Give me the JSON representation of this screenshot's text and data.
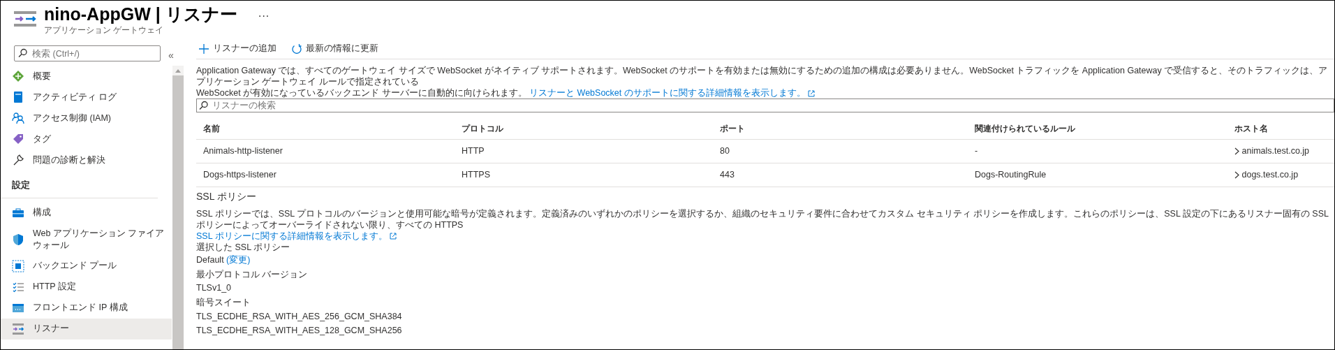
{
  "header": {
    "title": "nino-AppGW | リスナー",
    "subtitle": "アプリケーション ゲートウェイ",
    "more": "···"
  },
  "sidebar": {
    "search": {
      "placeholder": "検索 (Ctrl+/)"
    },
    "collapse": "«",
    "groups": [
      {
        "items": [
          {
            "label": "概要",
            "selected": false
          },
          {
            "label": "アクティビティ ログ",
            "selected": false
          },
          {
            "label": "アクセス制御 (IAM)",
            "selected": false
          },
          {
            "label": "タグ",
            "selected": false
          },
          {
            "label": "問題の診断と解決",
            "selected": false
          }
        ]
      },
      {
        "heading": "設定",
        "items": [
          {
            "label": "構成",
            "selected": false
          },
          {
            "label": "Web アプリケーション ファイアウォール",
            "selected": false
          },
          {
            "label": "バックエンド プール",
            "selected": false
          },
          {
            "label": "HTTP 設定",
            "selected": false
          },
          {
            "label": "フロントエンド IP 構成",
            "selected": false
          },
          {
            "label": "リスナー",
            "selected": true
          }
        ]
      }
    ]
  },
  "toolbar": [
    {
      "label": "リスナーの追加"
    },
    {
      "label": "最新の情報に更新"
    }
  ],
  "info": {
    "lines": [
      "Application Gateway では、すべてのゲートウェイ サイズで WebSocket がネイティブ サポートされます。WebSocket のサポートを有効または無効にするための追加の構成は必要ありません。WebSocket トラフィックを Application Gateway で受信すると、そのトラフィックは、アプリケーション ゲートウェイ ルールで指定されている",
      "WebSocket が有効になっているバックエンド サーバーに自動的に向けられます。"
    ],
    "link": "リスナーと WebSocket のサポートに関する詳細情報を表示します。"
  },
  "listener_search": {
    "placeholder": "リスナーの検索"
  },
  "table": {
    "columns": [
      "名前",
      "プロトコル",
      "ポート",
      "関連付けられているルール",
      "ホスト名"
    ],
    "rows": [
      [
        "Animals-http-listener",
        "HTTP",
        "80",
        "-",
        "animals.test.co.jp"
      ],
      [
        "Dogs-https-listener",
        "HTTPS",
        "443",
        "Dogs-RoutingRule",
        "dogs.test.co.jp"
      ]
    ]
  },
  "ssl": {
    "heading": "SSL ポリシー",
    "description": "SSL ポリシーでは、SSL プロトコルのバージョンと使用可能な暗号が定義されます。定義済みのいずれかのポリシーを選択するか、組織のセキュリティ要件に合わせてカスタム セキュリティ ポリシーを作成します。これらのポリシーは、SSL 設定の下にあるリスナー固有の SSL ポリシーによってオーバーライドされない限り、すべての HTTPS",
    "link": "SSL ポリシーに関する詳細情報を表示します。",
    "selected_label": "選択した SSL ポリシー",
    "selected_value": "Default",
    "change_link": "(変更)",
    "min_protocol_label": "最小プロトコル バージョン",
    "min_protocol_value": "TLSv1_0",
    "cipher_label": "暗号スイート",
    "ciphers": [
      "TLS_ECDHE_RSA_WITH_AES_256_GCM_SHA384",
      "TLS_ECDHE_RSA_WITH_AES_128_GCM_SHA256"
    ]
  }
}
